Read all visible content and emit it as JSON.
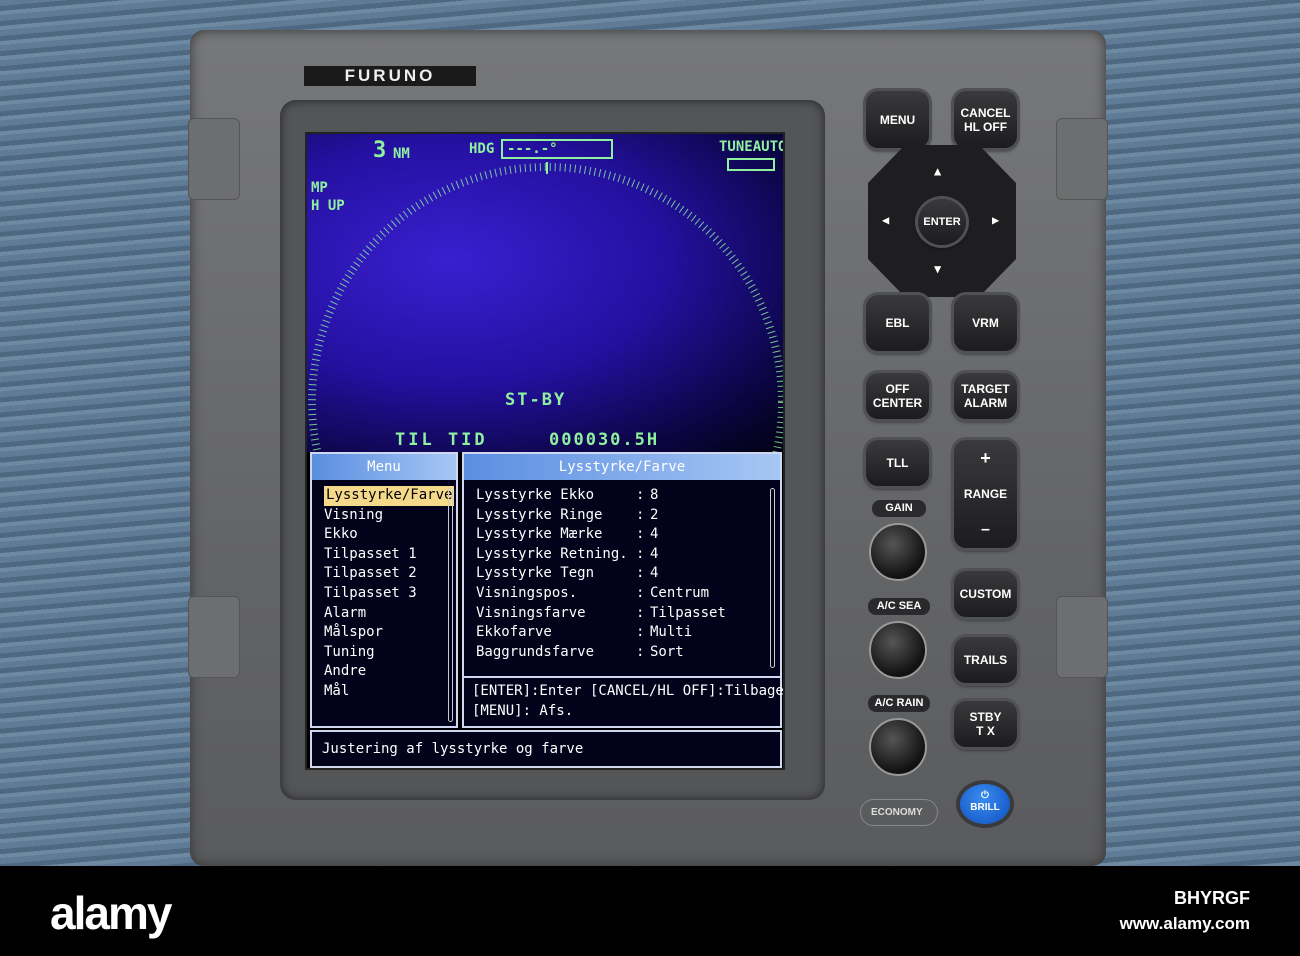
{
  "brand": "FURUNO",
  "radar": {
    "range": "3",
    "range_unit": "NM",
    "mode1": "MP",
    "mode2": "H UP",
    "hdg_label": "HDG",
    "hdg_value": "---.-°",
    "tune": "TUNEAUTO",
    "status": "ST-BY",
    "timer_label": "TIL TID",
    "timer_value": "000030.5H"
  },
  "menu": {
    "title": "Menu",
    "items": [
      "Lysstyrke/Farve",
      "Visning",
      "Ekko",
      "Tilpasset 1",
      "Tilpasset 2",
      "Tilpasset 3",
      "Alarm",
      "Målspor",
      "Tuning",
      "Andre",
      "Mål"
    ]
  },
  "submenu": {
    "title": "Lysstyrke/Farve",
    "rows": [
      {
        "label": "Lysstyrke Ekko",
        "value": "8"
      },
      {
        "label": "Lysstyrke Ringe",
        "value": "2"
      },
      {
        "label": "Lysstyrke Mærke",
        "value": "4"
      },
      {
        "label": "Lysstyrke Retning.",
        "value": "4"
      },
      {
        "label": "Lysstyrke Tegn",
        "value": "4"
      },
      {
        "label": "Visningspos.",
        "value": "Centrum"
      },
      {
        "label": "Visningsfarve",
        "value": "Tilpasset"
      },
      {
        "label": "Ekkofarve",
        "value": "Multi"
      },
      {
        "label": "Baggrundsfarve",
        "value": "Sort"
      }
    ],
    "hint1": "[ENTER]:Enter [CANCEL/HL OFF]:Tilbage",
    "hint2": "[MENU]: Afs."
  },
  "status_line": "Justering af lysstyrke og farve",
  "buttons": {
    "menu": "MENU",
    "cancel1": "CANCEL",
    "cancel2": "HL OFF",
    "enter": "ENTER",
    "ebl": "EBL",
    "vrm": "VRM",
    "off1": "OFF",
    "off2": "CENTER",
    "tgt1": "TARGET",
    "tgt2": "ALARM",
    "tll": "TLL",
    "range_plus": "+",
    "range": "RANGE",
    "range_minus": "–",
    "custom": "CUSTOM",
    "trails": "TRAILS",
    "stby1": "STBY",
    "stby2": "T X",
    "gain": "GAIN",
    "acsea": "A/C SEA",
    "acrain": "A/C RAIN",
    "economy": "ECONOMY",
    "brill": "BRILL"
  },
  "footer": {
    "logo": "alamy",
    "image_id": "BHYRGF",
    "url": "www.alamy.com"
  }
}
